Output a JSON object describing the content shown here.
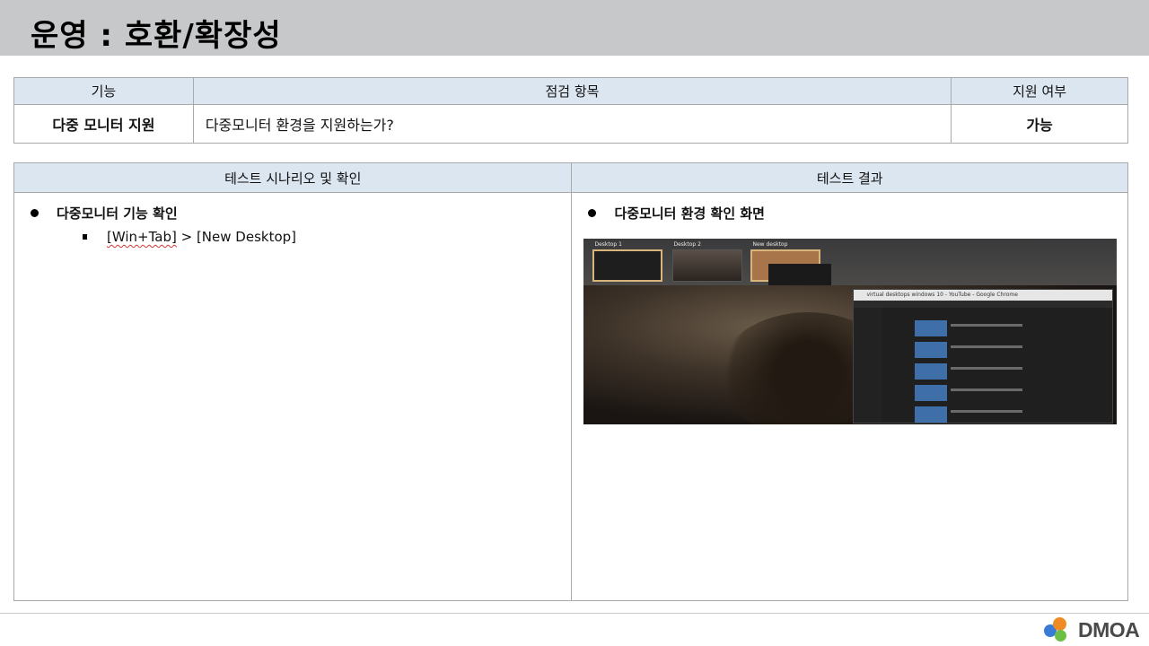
{
  "page": {
    "title": "운영 : 호환/확장성"
  },
  "check_table": {
    "headers": {
      "feature": "기능",
      "item": "점검 항목",
      "support": "지원 여부"
    },
    "row": {
      "feature": "다중 모니터 지원",
      "item": "다중모니터 환경을 지원하는가?",
      "support": "가능"
    }
  },
  "test_table": {
    "headers": {
      "scenario": "테스트 시나리오 및 확인",
      "result": "테스트 결과"
    },
    "scenario": {
      "bullet": "다중모니터 기능 확인",
      "sub_prefix": "[Win+Tab]",
      "sub_rest": " > [New Desktop]"
    },
    "result": {
      "bullet": "다중모니터 환경 확인 화면",
      "screenshot": {
        "desktops": [
          "Desktop 1",
          "Desktop 2",
          "New desktop"
        ],
        "window_title": "virtual desktops windows 10 - YouTube - Google Chrome"
      }
    }
  },
  "footer": {
    "logo_text": "DMOA",
    "colors": {
      "blue": "#3b7bd8",
      "orange": "#f08a24",
      "green": "#6cbf45"
    }
  }
}
